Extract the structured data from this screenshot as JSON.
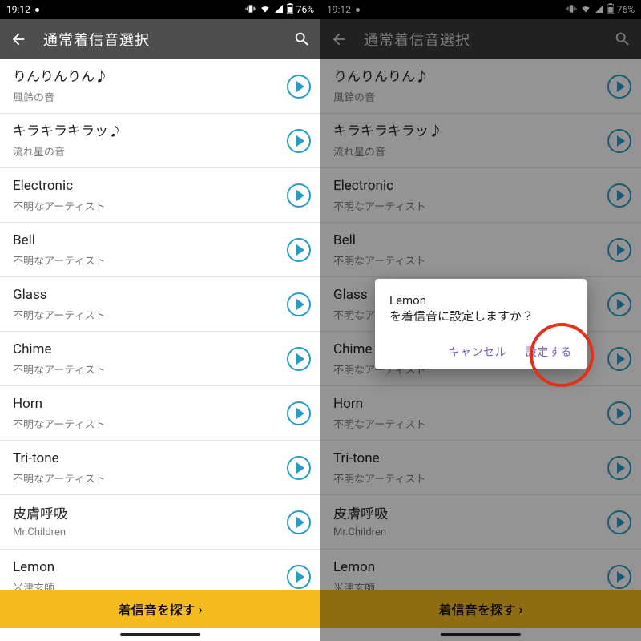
{
  "status": {
    "time": "19:12",
    "battery": "76%"
  },
  "appbar": {
    "title": "通常着信音選択"
  },
  "rows": [
    {
      "title": "りんりんりん♪",
      "sub": "風鈴の音"
    },
    {
      "title": "キラキラキラッ♪",
      "sub": "流れ星の音"
    },
    {
      "title": "Electronic",
      "sub": "不明なアーティスト"
    },
    {
      "title": "Bell",
      "sub": "不明なアーティスト"
    },
    {
      "title": "Glass",
      "sub": "不明なアーティスト"
    },
    {
      "title": "Chime",
      "sub": "不明なアーティスト"
    },
    {
      "title": "Horn",
      "sub": "不明なアーティスト"
    },
    {
      "title": "Tri-tone",
      "sub": "不明なアーティスト"
    },
    {
      "title": "皮膚呼吸",
      "sub": "Mr.Children"
    },
    {
      "title": "Lemon",
      "sub": "米津玄師"
    }
  ],
  "bottom": {
    "label": "着信音を探す"
  },
  "dialog": {
    "line1": "Lemon",
    "line2": "を着信音に設定しますか？",
    "cancel": "キャンセル",
    "ok": "設定する"
  }
}
